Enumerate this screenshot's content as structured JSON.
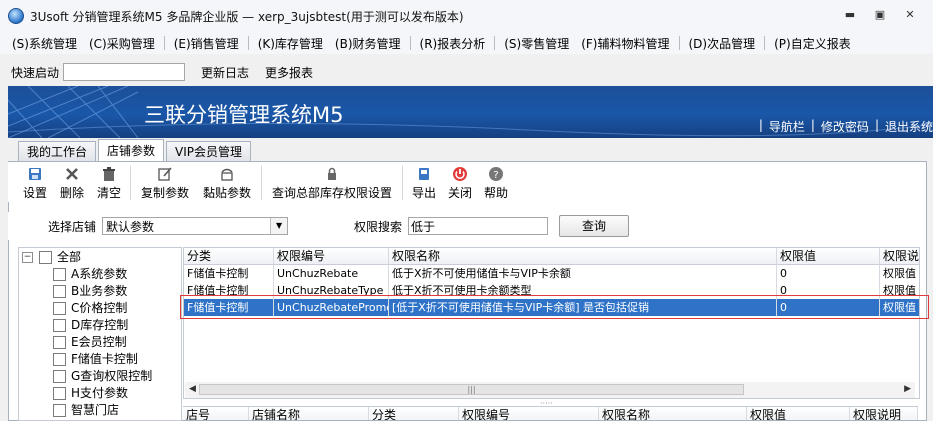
{
  "window": {
    "title": "3Usoft 分销管理系统M5 多品牌企业版 — xerp_3ujsbtest(用于测可以发布版本)",
    "controls": [
      "minimize-icon",
      "maximize-icon",
      "close-icon"
    ]
  },
  "menu": [
    "(S)系统管理",
    "(C)采购管理",
    "(E)销售管理",
    "(K)库存管理",
    "(B)财务管理",
    "(R)报表分析",
    "(S)零售管理",
    "(F)辅料物料管理",
    "(D)次品管理",
    "(P)自定义报表"
  ],
  "quickbar": {
    "label": "快速启动",
    "input_value": "",
    "links": [
      "更新日志",
      "更多报表"
    ]
  },
  "banner": {
    "title": "三联分销管理系统M5",
    "links": [
      "导航栏",
      "修改密码",
      "退出系统"
    ]
  },
  "tabs": [
    {
      "label": "我的工作台",
      "active": false
    },
    {
      "label": "店铺参数",
      "active": true
    },
    {
      "label": "VIP会员管理",
      "active": false
    }
  ],
  "toolbar": {
    "settings": "设置",
    "delete": "删除",
    "clear": "清空",
    "copy_params": "复制参数",
    "paste_params": "黏贴参数",
    "query_hq_stock": "查询总部库存权限设置",
    "export": "导出",
    "close": "关闭",
    "help": "帮助"
  },
  "filter": {
    "store_label": "选择店铺",
    "store_value": "默认参数",
    "search_label": "权限搜索",
    "search_value": "低于",
    "query_button": "查询"
  },
  "tree": {
    "root": "全部",
    "items": [
      "A系统参数",
      "B业务参数",
      "C价格控制",
      "D库存控制",
      "E会员控制",
      "F储值卡控制",
      "G查询权限控制",
      "H支付参数",
      "智慧门店"
    ]
  },
  "grid": {
    "columns": [
      "分类",
      "权限编号",
      "权限名称",
      "权限值",
      "权限说"
    ],
    "rows": [
      [
        "F储值卡控制",
        "UnChuzRebate",
        "低于X折不可使用储值卡与VIP卡余额",
        "0",
        "权限值"
      ],
      [
        "F储值卡控制",
        "UnChuzRebateType",
        "低于X折不可使用卡余额类型",
        "0",
        "权限值"
      ],
      [
        "F储值卡控制",
        "UnChuzRebatePromoti",
        "[低于X折不可使用储值卡与VIP卡余额] 是否包括促销",
        "0",
        "权限值"
      ]
    ],
    "selected_row": 2
  },
  "grid2": {
    "columns": [
      "店号",
      "店铺名称",
      "分类",
      "权限编号",
      "权限名称",
      "权限值",
      "权限说明"
    ]
  },
  "colors": {
    "banner": "#1a57a8",
    "selection": "#2f73c8",
    "highlight_border": "#e03a3a"
  }
}
